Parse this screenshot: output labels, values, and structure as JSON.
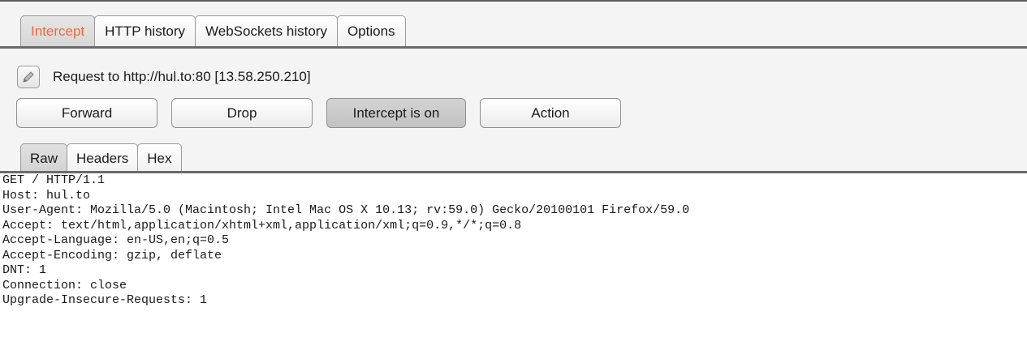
{
  "top_tabs": [
    {
      "label": "Intercept",
      "selected": true
    },
    {
      "label": "HTTP history",
      "selected": false
    },
    {
      "label": "WebSockets history",
      "selected": false
    },
    {
      "label": "Options",
      "selected": false
    }
  ],
  "request": {
    "icon": "pencil-icon",
    "label": "Request to http://hul.to:80  [13.58.250.210]"
  },
  "buttons": {
    "forward": "Forward",
    "drop": "Drop",
    "intercept": "Intercept is on",
    "action": "Action"
  },
  "sub_tabs": [
    {
      "label": "Raw",
      "selected": true
    },
    {
      "label": "Headers",
      "selected": false
    },
    {
      "label": "Hex",
      "selected": false
    }
  ],
  "raw_lines": [
    "GET / HTTP/1.1",
    "Host: hul.to",
    "User-Agent: Mozilla/5.0 (Macintosh; Intel Mac OS X 10.13; rv:59.0) Gecko/20100101 Firefox/59.0",
    "Accept: text/html,application/xhtml+xml,application/xml;q=0.9,*/*;q=0.8",
    "Accept-Language: en-US,en;q=0.5",
    "Accept-Encoding: gzip, deflate",
    "DNT: 1",
    "Connection: close",
    "Upgrade-Insecure-Requests: 1"
  ],
  "colors": {
    "selected_tab_text": "#ee6a3b",
    "panel_background": "#f4f4f4",
    "divider": "#6a6a6a"
  }
}
